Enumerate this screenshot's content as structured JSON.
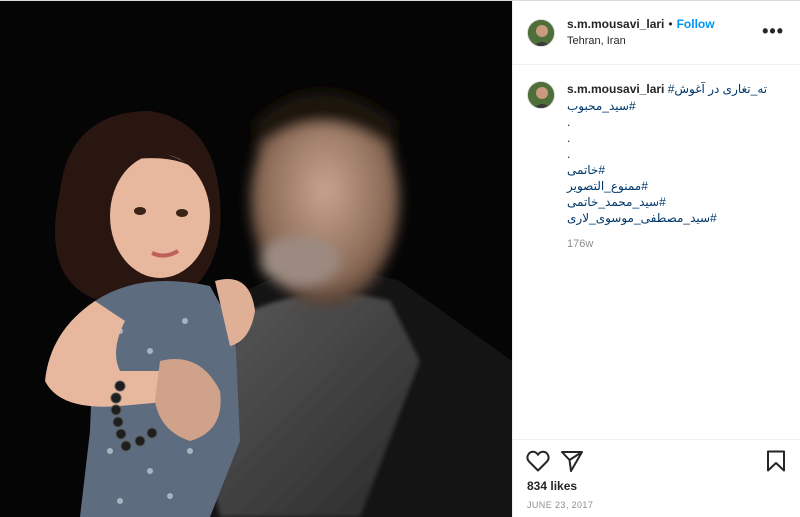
{
  "post": {
    "username": "s.m.mousavi_lari",
    "separator": "•",
    "follow_label": "Follow",
    "location": "Tehran, Iran",
    "more_label": "•••",
    "caption": {
      "username": "s.m.mousavi_lari",
      "first_line": "ته_تغاری در آغوش#",
      "lines": [
        "#سید_محبوب",
        ".",
        ".",
        ".",
        "#خاتمی",
        "#ممنوع_التصویر",
        "#سید_محمد_خاتمی",
        "#سید_مصطفی_موسوی_لاری"
      ],
      "time_ago": "176w"
    },
    "likes": "834 likes",
    "date": "JUNE 23, 2017"
  },
  "icons": {
    "like": "heart-icon",
    "share": "send-icon",
    "save": "bookmark-icon",
    "more": "more-options-icon"
  },
  "colors": {
    "follow": "#0095f6",
    "hashtag": "#00376b",
    "muted": "#8e8e8e"
  }
}
